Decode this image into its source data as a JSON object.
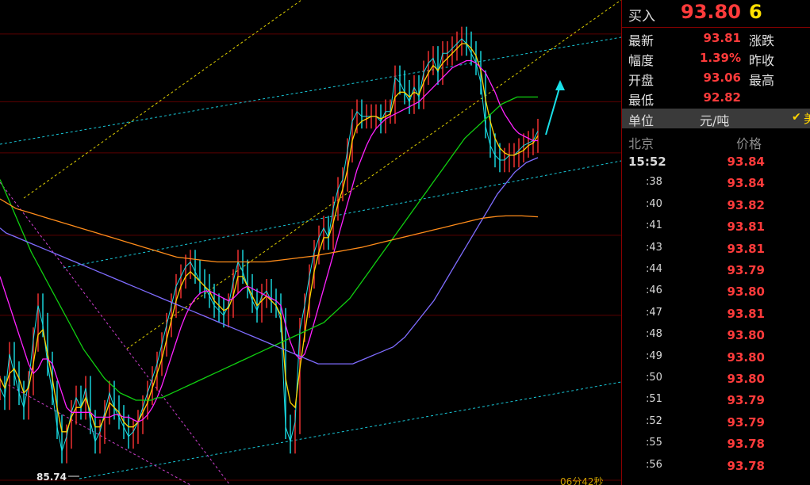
{
  "quote": {
    "title": "买入",
    "price": "93.80",
    "volume": "6",
    "stats": [
      {
        "label": "最新",
        "value": "93.81",
        "label2": "涨跌"
      },
      {
        "label": "幅度",
        "value": "1.39%",
        "label2": "昨收"
      },
      {
        "label": "开盘",
        "value": "93.06",
        "label2": "最高"
      },
      {
        "label": "最低",
        "value": "92.82",
        "label2": ""
      }
    ],
    "unit_label": "单位",
    "unit_value": "元/吨",
    "check_icon": "check-icon",
    "check_tail": "美"
  },
  "ticks": {
    "header_place": "北京",
    "header_price": "价格",
    "rows": [
      {
        "time": "15:52",
        "price": "93.84"
      },
      {
        "time": ":38",
        "price": "93.84"
      },
      {
        "time": ":40",
        "price": "93.82"
      },
      {
        "time": ":41",
        "price": "93.81"
      },
      {
        "time": ":43",
        "price": "93.81"
      },
      {
        "time": ":44",
        "price": "93.79"
      },
      {
        "time": ":46",
        "price": "93.80"
      },
      {
        "time": ":47",
        "price": "93.81"
      },
      {
        "time": ":48",
        "price": "93.80"
      },
      {
        "time": ":49",
        "price": "93.80"
      },
      {
        "time": ":50",
        "price": "93.80"
      },
      {
        "time": ":51",
        "price": "93.79"
      },
      {
        "time": ":52",
        "price": "93.79"
      },
      {
        "time": ":55",
        "price": "93.78"
      },
      {
        "time": ":56",
        "price": "93.78"
      }
    ]
  },
  "chart_data": {
    "type": "line",
    "ylim": [
      85.4,
      95.3
    ],
    "low_label": "85.74",
    "countdown_label": "06分42秒",
    "grid": true,
    "h_levels": [
      94.6,
      93.2,
      92.15,
      90.45,
      88.8,
      85.4
    ],
    "series": [
      {
        "name": "",
        "color": "#19e0e8",
        "values": [
          87.3,
          87.1,
          88.0,
          87.6,
          87.2,
          86.9,
          87.4,
          88.3,
          89.0,
          88.6,
          87.8,
          87.2,
          86.5,
          86.0,
          86.3,
          86.8,
          87.1,
          86.9,
          87.3,
          86.6,
          86.2,
          86.4,
          86.8,
          87.2,
          86.9,
          86.7,
          86.5,
          86.3,
          86.4,
          86.6,
          86.9,
          87.2,
          87.5,
          87.8,
          88.2,
          88.6,
          89.0,
          89.4,
          89.6,
          89.8,
          89.9,
          89.7,
          89.5,
          89.4,
          89.2,
          89.0,
          88.9,
          88.8,
          89.0,
          89.5,
          89.9,
          89.7,
          89.4,
          89.1,
          88.9,
          89.2,
          89.3,
          89.1,
          89.0,
          88.7,
          86.5,
          86.2,
          86.6,
          88.5,
          89.0,
          89.6,
          90.1,
          90.4,
          90.6,
          90.4,
          91.0,
          91.4,
          91.6,
          92.2,
          92.8,
          93.0,
          92.9,
          92.9,
          92.9,
          92.9,
          92.8,
          93.0,
          93.0,
          93.7,
          93.6,
          93.4,
          93.2,
          93.5,
          93.3,
          93.8,
          94.0,
          94.1,
          93.8,
          94.2,
          94.2,
          94.3,
          94.4,
          94.5,
          94.4,
          94.2,
          94.0,
          93.6,
          92.7,
          92.3,
          92.1,
          92.0,
          92.0,
          92.1,
          92.1,
          92.2,
          92.3,
          92.35,
          92.4,
          92.6
        ]
      },
      {
        "name": "",
        "color": "#ffd400",
        "values": [
          87.5,
          87.3,
          87.6,
          87.7,
          87.5,
          87.2,
          87.3,
          87.8,
          88.4,
          88.5,
          88.0,
          87.5,
          86.9,
          86.4,
          86.4,
          86.7,
          86.9,
          86.9,
          87.1,
          86.8,
          86.5,
          86.5,
          86.7,
          87.0,
          86.9,
          86.8,
          86.6,
          86.5,
          86.5,
          86.6,
          86.8,
          87.0,
          87.3,
          87.6,
          87.9,
          88.3,
          88.7,
          89.1,
          89.4,
          89.6,
          89.7,
          89.6,
          89.5,
          89.4,
          89.3,
          89.1,
          89.0,
          88.9,
          88.95,
          89.2,
          89.6,
          89.6,
          89.4,
          89.2,
          89.0,
          89.1,
          89.2,
          89.1,
          89.0,
          88.8,
          87.5,
          87.0,
          86.9,
          87.7,
          88.4,
          89.1,
          89.7,
          90.1,
          90.4,
          90.4,
          90.7,
          91.1,
          91.4,
          91.8,
          92.4,
          92.7,
          92.8,
          92.85,
          92.9,
          92.9,
          92.85,
          92.9,
          92.95,
          93.3,
          93.4,
          93.4,
          93.3,
          93.4,
          93.35,
          93.6,
          93.8,
          93.95,
          93.85,
          94.0,
          94.1,
          94.2,
          94.3,
          94.4,
          94.4,
          94.3,
          94.15,
          93.85,
          93.25,
          92.8,
          92.45,
          92.25,
          92.15,
          92.1,
          92.1,
          92.15,
          92.2,
          92.3,
          92.35,
          92.5
        ]
      },
      {
        "name": "",
        "color": "#ff22ff",
        "values": [
          89.6,
          89.3,
          89.0,
          88.7,
          88.4,
          88.1,
          87.8,
          87.6,
          87.7,
          87.9,
          87.9,
          87.8,
          87.5,
          87.2,
          86.9,
          86.8,
          86.8,
          86.8,
          86.8,
          86.8,
          86.7,
          86.7,
          86.7,
          86.7,
          86.75,
          86.75,
          86.7,
          86.7,
          86.65,
          86.6,
          86.65,
          86.75,
          86.9,
          87.1,
          87.35,
          87.65,
          87.95,
          88.25,
          88.55,
          88.8,
          89.0,
          89.15,
          89.25,
          89.3,
          89.3,
          89.25,
          89.2,
          89.15,
          89.1,
          89.15,
          89.25,
          89.35,
          89.4,
          89.35,
          89.3,
          89.25,
          89.2,
          89.15,
          89.1,
          89.0,
          88.6,
          88.25,
          88.0,
          87.9,
          88.0,
          88.3,
          88.65,
          89.0,
          89.35,
          89.7,
          90.05,
          90.4,
          90.75,
          91.1,
          91.45,
          91.8,
          92.05,
          92.3,
          92.5,
          92.65,
          92.75,
          92.85,
          92.9,
          92.95,
          93.0,
          93.05,
          93.1,
          93.15,
          93.2,
          93.3,
          93.4,
          93.5,
          93.6,
          93.7,
          93.8,
          93.9,
          93.95,
          94.0,
          94.05,
          94.05,
          94.0,
          93.9,
          93.8,
          93.6,
          93.4,
          93.15,
          92.95,
          92.8,
          92.65,
          92.55,
          92.5,
          92.45,
          92.4,
          92.4
        ]
      },
      {
        "name": "",
        "color": "#10d010",
        "values": [
          91.6,
          91.35,
          91.1,
          90.85,
          90.6,
          90.35,
          90.1,
          89.9,
          89.7,
          89.5,
          89.3,
          89.1,
          88.9,
          88.7,
          88.5,
          88.3,
          88.1,
          87.95,
          87.8,
          87.65,
          87.5,
          87.4,
          87.3,
          87.2,
          87.15,
          87.1,
          87.05,
          87.05,
          87.05,
          87.05,
          87.1,
          87.1,
          87.15,
          87.2,
          87.25,
          87.3,
          87.35,
          87.4,
          87.45,
          87.5,
          87.55,
          87.6,
          87.65,
          87.7,
          87.75,
          87.8,
          87.85,
          87.9,
          87.95,
          88.0,
          88.05,
          88.1,
          88.15,
          88.2,
          88.25,
          88.3,
          88.35,
          88.4,
          88.45,
          88.5,
          88.55,
          88.6,
          88.65,
          88.75,
          88.85,
          88.95,
          89.05,
          89.15,
          89.3,
          89.45,
          89.6,
          89.75,
          89.9,
          90.05,
          90.2,
          90.35,
          90.5,
          90.65,
          90.8,
          90.95,
          91.1,
          91.25,
          91.4,
          91.55,
          91.7,
          91.85,
          92.0,
          92.15,
          92.3,
          92.45,
          92.55,
          92.65,
          92.75,
          92.85,
          92.95,
          93.05,
          93.15,
          93.2,
          93.25,
          93.3,
          93.3,
          93.3,
          93.3,
          93.3
        ]
      },
      {
        "name": "",
        "color": "#7f6cff",
        "values": [
          90.6,
          90.5,
          90.45,
          90.4,
          90.35,
          90.3,
          90.25,
          90.2,
          90.15,
          90.1,
          90.05,
          90.0,
          89.95,
          89.9,
          89.85,
          89.8,
          89.75,
          89.7,
          89.65,
          89.6,
          89.55,
          89.5,
          89.45,
          89.4,
          89.35,
          89.3,
          89.25,
          89.2,
          89.15,
          89.1,
          89.05,
          89.0,
          88.95,
          88.9,
          88.85,
          88.8,
          88.75,
          88.7,
          88.65,
          88.6,
          88.55,
          88.5,
          88.45,
          88.4,
          88.35,
          88.3,
          88.25,
          88.2,
          88.15,
          88.1,
          88.05,
          88.0,
          87.95,
          87.9,
          87.85,
          87.8,
          87.8,
          87.8,
          87.8,
          87.8,
          87.8,
          87.8,
          87.85,
          87.9,
          87.95,
          88.0,
          88.05,
          88.1,
          88.15,
          88.25,
          88.35,
          88.5,
          88.65,
          88.8,
          88.95,
          89.1,
          89.3,
          89.5,
          89.7,
          89.9,
          90.1,
          90.3,
          90.5,
          90.7,
          90.9,
          91.1,
          91.3,
          91.45,
          91.6,
          91.75,
          91.85,
          91.95,
          92.0,
          92.05
        ]
      },
      {
        "name": "",
        "color": "#ff8c1a",
        "values": [
          91.2,
          91.1,
          91.0,
          90.95,
          90.9,
          90.85,
          90.8,
          90.75,
          90.7,
          90.65,
          90.6,
          90.55,
          90.5,
          90.45,
          90.4,
          90.35,
          90.3,
          90.25,
          90.2,
          90.15,
          90.1,
          90.05,
          90.0,
          89.98,
          89.96,
          89.94,
          89.92,
          89.9,
          89.9,
          89.9,
          89.9,
          89.9,
          89.9,
          89.9,
          89.92,
          89.94,
          89.96,
          89.98,
          90.0,
          90.02,
          90.05,
          90.08,
          90.11,
          90.14,
          90.17,
          90.2,
          90.24,
          90.28,
          90.32,
          90.36,
          90.4,
          90.44,
          90.48,
          90.52,
          90.56,
          90.6,
          90.64,
          90.68,
          90.72,
          90.76,
          90.8,
          90.82,
          90.84,
          90.85,
          90.85,
          90.85,
          90.84,
          90.83
        ]
      }
    ]
  }
}
